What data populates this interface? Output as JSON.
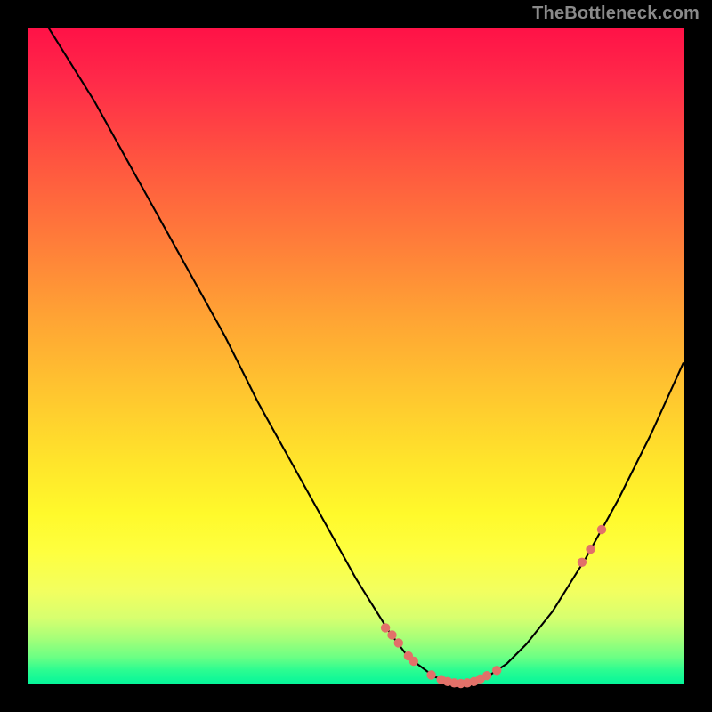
{
  "attribution": "TheBottleneck.com",
  "chart_data": {
    "type": "line",
    "title": "",
    "xlabel": "",
    "ylabel": "",
    "xlim": [
      0,
      100
    ],
    "ylim": [
      0,
      100
    ],
    "grid": false,
    "legend": false,
    "background_gradient": {
      "top": "#ff1247",
      "mid": "#ffe42b",
      "bottom": "#06f69a"
    },
    "series": [
      {
        "name": "bottleneck-curve",
        "x": [
          0,
          5,
          10,
          15,
          20,
          25,
          30,
          35,
          40,
          45,
          50,
          55,
          58,
          62,
          66,
          70,
          73,
          76,
          80,
          85,
          90,
          95,
          100
        ],
        "values": [
          105,
          97,
          89,
          80,
          71,
          62,
          53,
          43,
          34,
          25,
          16,
          8,
          4,
          1,
          0,
          1,
          3,
          6,
          11,
          19,
          28,
          38,
          49
        ]
      }
    ],
    "markers": [
      {
        "x": 54.5,
        "y": 8.5
      },
      {
        "x": 55.5,
        "y": 7.4
      },
      {
        "x": 56.5,
        "y": 6.2
      },
      {
        "x": 58.0,
        "y": 4.2
      },
      {
        "x": 58.8,
        "y": 3.4
      },
      {
        "x": 61.5,
        "y": 1.3
      },
      {
        "x": 63.0,
        "y": 0.6
      },
      {
        "x": 64.0,
        "y": 0.3
      },
      {
        "x": 65.0,
        "y": 0.1
      },
      {
        "x": 66.0,
        "y": 0.0
      },
      {
        "x": 67.0,
        "y": 0.1
      },
      {
        "x": 68.0,
        "y": 0.3
      },
      {
        "x": 69.0,
        "y": 0.7
      },
      {
        "x": 70.0,
        "y": 1.2
      },
      {
        "x": 71.5,
        "y": 2.0
      },
      {
        "x": 84.5,
        "y": 18.5
      },
      {
        "x": 85.8,
        "y": 20.5
      },
      {
        "x": 87.5,
        "y": 23.5
      }
    ],
    "marker_color": "#e27169",
    "curve_color": "#000000"
  }
}
